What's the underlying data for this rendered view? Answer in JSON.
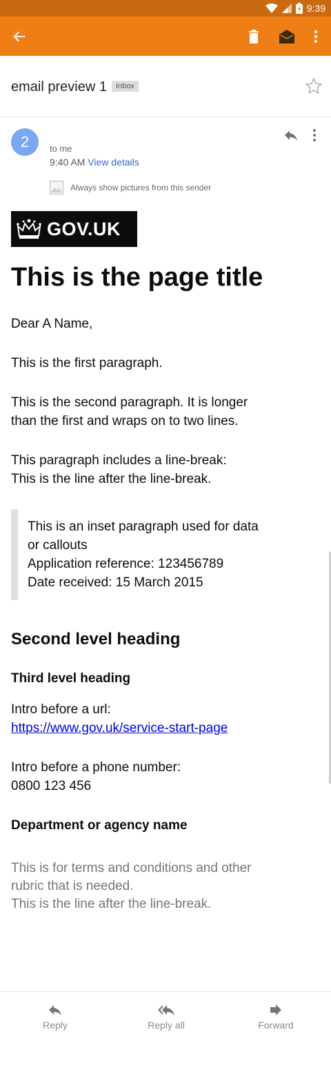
{
  "status_bar": {
    "time": "9:39",
    "icons": [
      "wifi-icon",
      "signal-icon",
      "battery-icon"
    ]
  },
  "app_bar": {
    "actions": [
      "back-icon",
      "delete-icon",
      "mark-unread-icon",
      "more-icon"
    ],
    "color": "#ef7e14"
  },
  "subject": {
    "title": "email preview 1",
    "badge": "Inbox"
  },
  "sender": {
    "avatar_letter": "2",
    "to": "to me",
    "time": "9:40 AM",
    "view_details": "View details",
    "pictures_notice": "Always show pictures from this sender"
  },
  "email": {
    "logo_text": "GOV.UK",
    "page_title": "This is the page title",
    "greeting": "Dear A Name,",
    "paragraph_1": "This is the first paragraph.",
    "paragraph_2": "This is the second paragraph. It is longer than the first and wraps on to two lines.",
    "linebreak_line_1": "This paragraph includes a line-break:",
    "linebreak_line_2": "This is the line after the line-break.",
    "inset_line_1": "This is an inset paragraph used for data or callouts",
    "inset_line_2": "Application reference: 123456789",
    "inset_line_3": "Date received: 15 March 2015",
    "second_heading": "Second level heading",
    "third_heading": "Third level heading",
    "url_intro": "Intro before a url:",
    "url": "https://www.gov.uk/service-start-page",
    "phone_intro": "Intro before a phone number:",
    "phone": "0800 123 456",
    "department": "Department or agency name",
    "rubric_line_1": "This is for terms and conditions and other rubric that is needed.",
    "rubric_line_2": "This is the line after the line-break."
  },
  "bottom_actions": {
    "reply": "Reply",
    "reply_all": "Reply all",
    "forward": "Forward"
  }
}
